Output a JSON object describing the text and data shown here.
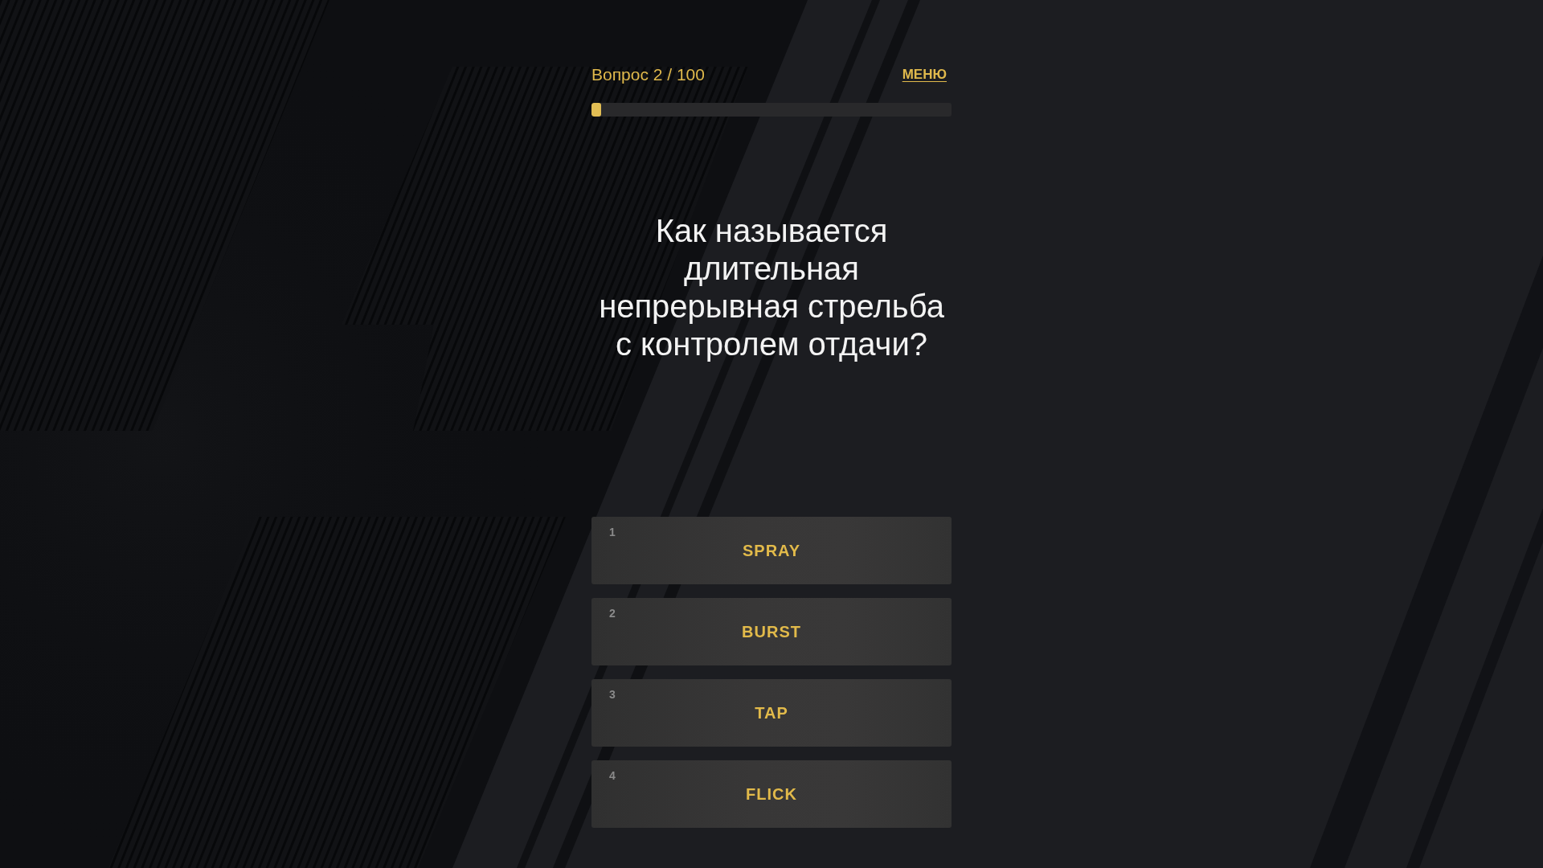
{
  "header": {
    "question_counter": "Вопрос 2 / 100",
    "menu_link": "МЕНЮ"
  },
  "progress": {
    "level": 0.02
  },
  "question": "Как называется длительная непрерывная стрельба с контролем отдачи?",
  "answers": [
    {
      "number": "1",
      "label": "SPRAY"
    },
    {
      "number": "2",
      "label": "BURST"
    },
    {
      "number": "3",
      "label": "TAP"
    },
    {
      "number": "4",
      "label": "FLICK"
    }
  ]
}
